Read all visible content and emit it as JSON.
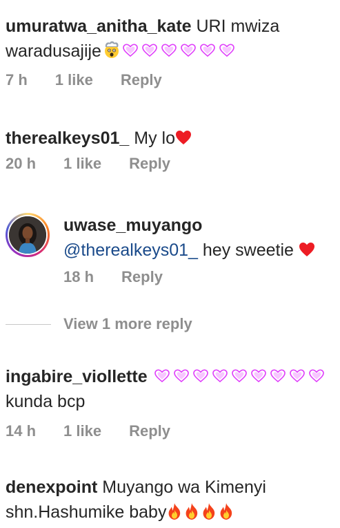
{
  "comments": [
    {
      "username": "umuratwa_anitha_kate",
      "text_line1": " URI mwiza",
      "text_line2": "waradusajije",
      "emoji": "exploding-head-emoji",
      "hearts": 6,
      "time": "7 h",
      "likes": "1 like",
      "reply": "Reply"
    },
    {
      "username": "therealkeys01_",
      "text": " My lo",
      "time": "20 h",
      "likes": "1 like",
      "reply": "Reply"
    },
    {
      "username": "ingabire_viollette",
      "hearts": 9,
      "text_line2": "kunda bcp",
      "time": "14 h",
      "likes": "1 like",
      "reply": "Reply"
    },
    {
      "username": "denexpoint",
      "text_line1": " Muyango wa Kimenyi",
      "text_line2": "shn.Hashumike baby",
      "fire_count": 4
    }
  ],
  "reply": {
    "username": "uwase_muyango",
    "mention": "@therealkeys01_",
    "text": " hey sweetie ",
    "time": "18 h",
    "reply": "Reply"
  },
  "view_more": "View 1 more reply",
  "colors": {
    "text": "#262626",
    "meta": "#8e8e8e",
    "mention": "#1a4a8a",
    "heart_red": "#ed1c24",
    "heart_purple": "#e040fb"
  }
}
